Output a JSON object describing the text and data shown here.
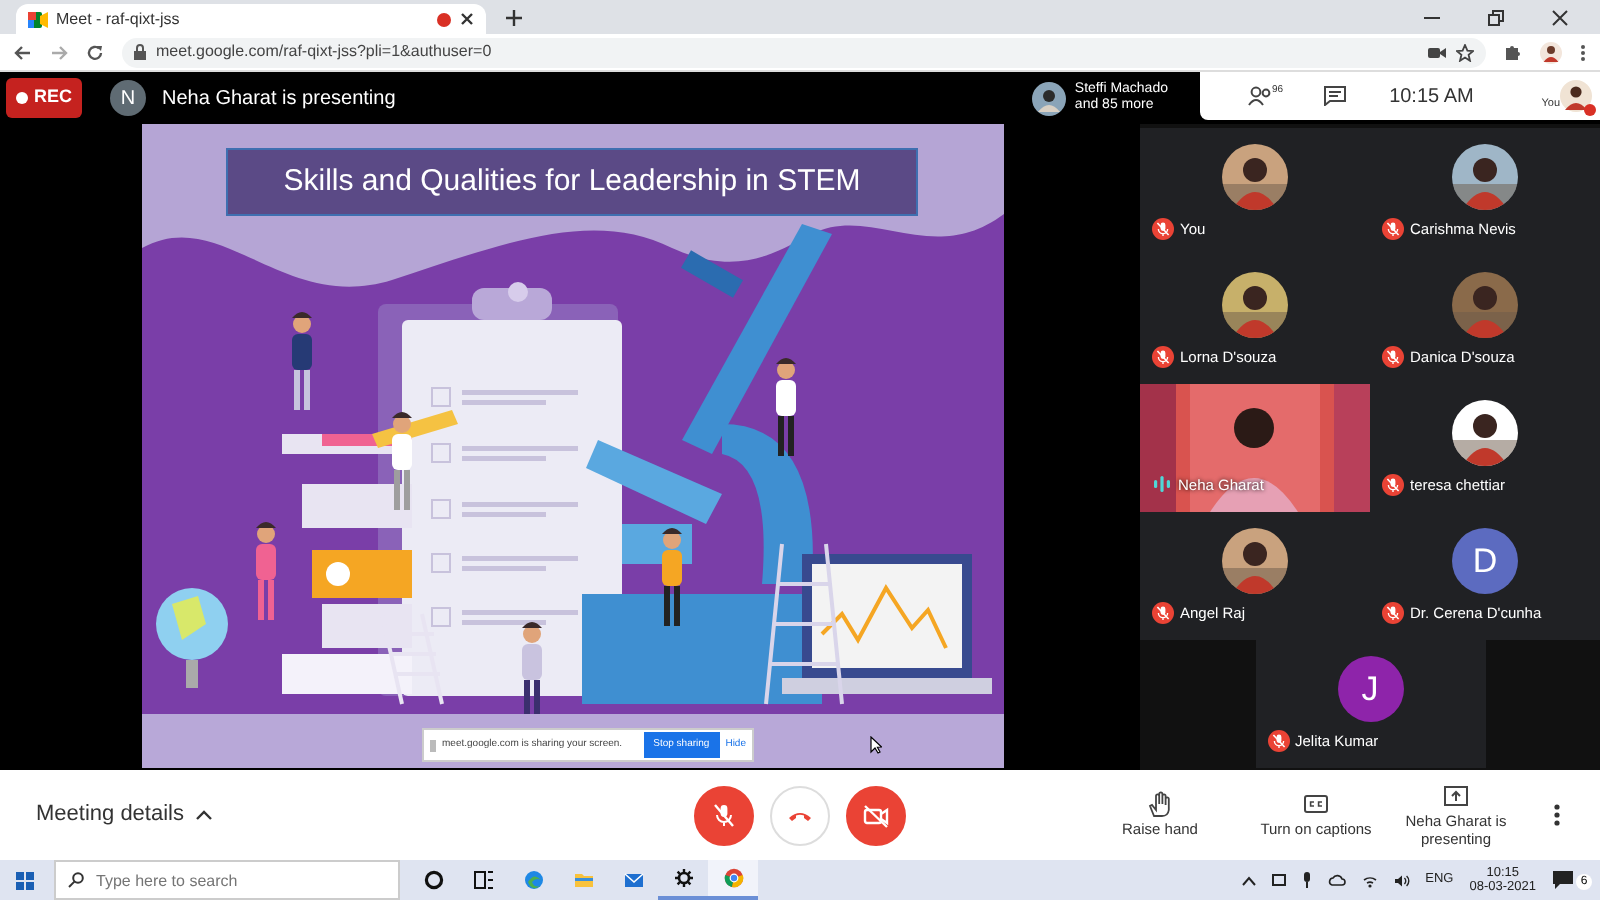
{
  "browser": {
    "tab": {
      "title": "Meet - raf-qixt-jss",
      "recording": true
    },
    "url": "meet.google.com/raf-qixt-jss?pli=1&authuser=0"
  },
  "top_bar": {
    "rec_label": "REC",
    "presenter_initial": "N",
    "presenting_text": "Neha Gharat is presenting",
    "viewer_name": "Steffi Machado",
    "viewer_more": "and 85 more",
    "people_count": "96",
    "time": "10:15 AM",
    "self_label": "You"
  },
  "slide": {
    "title": "Skills and Qualities for Leadership in STEM",
    "share_banner": {
      "message": "meet.google.com is sharing your screen.",
      "stop_button": "Stop sharing",
      "hide_link": "Hide"
    }
  },
  "participants": [
    {
      "name": "You",
      "muted": true
    },
    {
      "name": "Carishma Nevis",
      "muted": true
    },
    {
      "name": "Lorna D'souza",
      "muted": true
    },
    {
      "name": "Danica D'souza",
      "muted": true
    },
    {
      "name": "Neha Gharat",
      "kind": "video",
      "muted": false
    },
    {
      "name": "teresa chettiar",
      "muted": true
    },
    {
      "name": "Angel Raj",
      "muted": true
    },
    {
      "name": "Dr. Cerena D'cunha",
      "kind": "letter",
      "initial": "D",
      "color": "#5c6bc0",
      "muted": true
    },
    {
      "name": "Jelita Kumar",
      "kind": "letter",
      "initial": "J",
      "color": "#8e24aa",
      "muted": true
    }
  ],
  "bottom_bar": {
    "meeting_details": "Meeting details",
    "controls": [
      {
        "kind": "mic",
        "on": false
      },
      {
        "kind": "hangup"
      },
      {
        "kind": "camera",
        "on": false
      }
    ],
    "actions": [
      {
        "kind": "hand",
        "label": "Raise hand"
      },
      {
        "kind": "captions",
        "label": "Turn on captions"
      },
      {
        "kind": "present",
        "label": "Neha Gharat is presenting"
      }
    ]
  },
  "taskbar": {
    "search_placeholder": "Type here to search",
    "apps": [
      {
        "kind": "cortana",
        "running": false,
        "selected": false
      },
      {
        "kind": "taskview",
        "running": false,
        "selected": false
      },
      {
        "kind": "edge",
        "running": false,
        "selected": false
      },
      {
        "kind": "explorer",
        "running": false,
        "selected": false
      },
      {
        "kind": "mail",
        "running": false,
        "selected": false
      },
      {
        "kind": "settings",
        "running": true,
        "selected": false
      },
      {
        "kind": "chrome",
        "running": true,
        "selected": true
      }
    ],
    "language": "ENG",
    "time": "10:15",
    "date": "08-03-2021",
    "notification_count": "6"
  }
}
